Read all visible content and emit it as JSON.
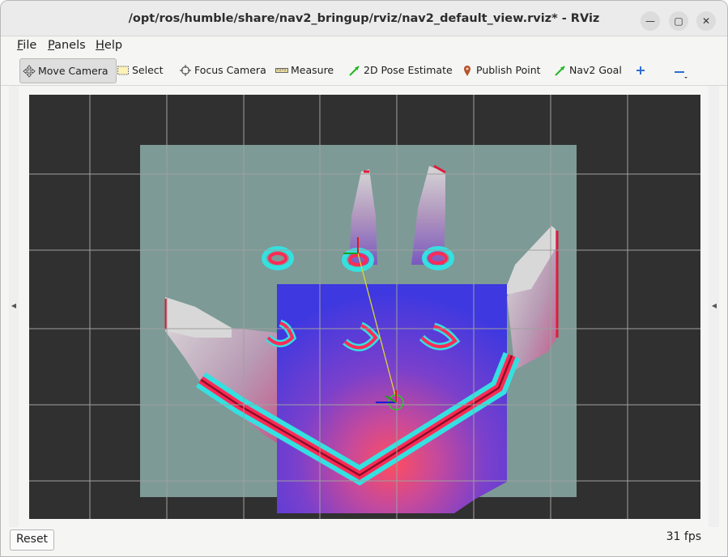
{
  "window": {
    "title": "/opt/ros/humble/share/nav2_bringup/rviz/nav2_default_view.rviz* - RViz",
    "minimize_glyph": "—",
    "maximize_glyph": "▢",
    "close_glyph": "✕"
  },
  "menu": {
    "file": {
      "accel": "F",
      "rest": "ile"
    },
    "panels": {
      "accel": "P",
      "rest": "anels"
    },
    "help": {
      "accel": "H",
      "rest": "elp"
    }
  },
  "toolbar": {
    "move_camera": "Move Camera",
    "select": "Select",
    "focus_camera": "Focus Camera",
    "measure": "Measure",
    "pose_estimate": "2D Pose Estimate",
    "publish_point": "Publish Point",
    "nav2_goal": "Nav2 Goal",
    "add_icon": "plus-icon",
    "remove_icon": "minus-icon"
  },
  "colors": {
    "grid": "#a0a0a0",
    "map_free": "#7d9a96",
    "costmap_low": "#3d38e0",
    "costmap_high": "#ff2a56",
    "inflation_edge": "#35e0e0",
    "path": "#d8d830"
  },
  "status": {
    "reset": "Reset",
    "fps": "31 fps"
  }
}
